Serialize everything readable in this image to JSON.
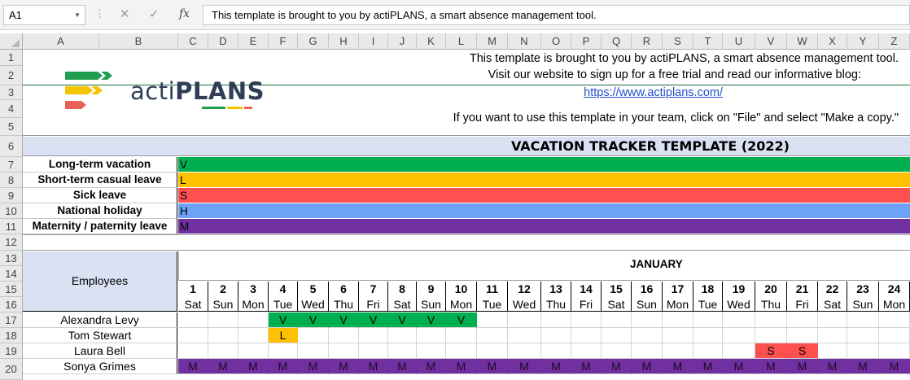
{
  "formula_bar": {
    "name_box": "A1",
    "cancel_icon": "✕",
    "enter_icon": "✓",
    "fx_icon": "fx",
    "formula": "This template is brought to you by actiPLANS, a smart absence management tool."
  },
  "columns": [
    "A",
    "B",
    "C",
    "D",
    "E",
    "F",
    "G",
    "H",
    "I",
    "J",
    "K",
    "L",
    "M",
    "N",
    "O",
    "P",
    "Q",
    "R",
    "S",
    "T",
    "U",
    "V",
    "W",
    "X",
    "Y",
    "Z"
  ],
  "rows": [
    "1",
    "2",
    "3",
    "4",
    "5",
    "6",
    "7",
    "8",
    "9",
    "10",
    "11",
    "12",
    "13",
    "14",
    "15",
    "16",
    "17",
    "18",
    "19",
    "20"
  ],
  "logo": {
    "text_a": "acti",
    "text_b": "PLANS"
  },
  "info": {
    "line1": "This template is brought to you by actiPLANS, a smart absence management tool.",
    "line2": "Visit our website to sign up for a free trial and read our informative blog:",
    "link": "https://www.actiplans.com/",
    "line4": "If you want to use this template in your team, click on \"File\" and select \"Make a copy.\""
  },
  "title": "VACATION TRACKER TEMPLATE (2022)",
  "legend": [
    {
      "label": "Long-term vacation",
      "code": "V",
      "color": "#00b050"
    },
    {
      "label": "Short-term casual leave",
      "code": "L",
      "color": "#ffc000"
    },
    {
      "label": "Sick leave",
      "code": "S",
      "color": "#ff5050"
    },
    {
      "label": "National holiday",
      "code": "H",
      "color": "#6ea2f6"
    },
    {
      "label": "Maternity / paternity leave",
      "code": "M",
      "color": "#7030a0"
    }
  ],
  "employees_header": "Employees",
  "month": "JANUARY",
  "days": [
    {
      "num": "1",
      "name": "Sat"
    },
    {
      "num": "2",
      "name": "Sun"
    },
    {
      "num": "3",
      "name": "Mon"
    },
    {
      "num": "4",
      "name": "Tue"
    },
    {
      "num": "5",
      "name": "Wed"
    },
    {
      "num": "6",
      "name": "Thu"
    },
    {
      "num": "7",
      "name": "Fri"
    },
    {
      "num": "8",
      "name": "Sat"
    },
    {
      "num": "9",
      "name": "Sun"
    },
    {
      "num": "10",
      "name": "Mon"
    },
    {
      "num": "11",
      "name": "Tue"
    },
    {
      "num": "12",
      "name": "Wed"
    },
    {
      "num": "13",
      "name": "Thu"
    },
    {
      "num": "14",
      "name": "Fri"
    },
    {
      "num": "15",
      "name": "Sat"
    },
    {
      "num": "16",
      "name": "Sun"
    },
    {
      "num": "17",
      "name": "Mon"
    },
    {
      "num": "18",
      "name": "Tue"
    },
    {
      "num": "19",
      "name": "Wed"
    },
    {
      "num": "20",
      "name": "Thu"
    },
    {
      "num": "21",
      "name": "Fri"
    },
    {
      "num": "22",
      "name": "Sat"
    },
    {
      "num": "23",
      "name": "Sun"
    },
    {
      "num": "24",
      "name": "Mon"
    }
  ],
  "employees": [
    {
      "name": "Alexandra Levy",
      "absences": {
        "4": "V",
        "5": "V",
        "6": "V",
        "7": "V",
        "8": "V",
        "9": "V",
        "10": "V"
      }
    },
    {
      "name": "Tom Stewart",
      "absences": {
        "4": "L"
      }
    },
    {
      "name": "Laura Bell",
      "absences": {
        "20": "S",
        "21": "S"
      }
    },
    {
      "name": "Sonya Grimes",
      "absences": {
        "1": "M",
        "2": "M",
        "3": "M",
        "4": "M",
        "5": "M",
        "6": "M",
        "7": "M",
        "8": "M",
        "9": "M",
        "10": "M",
        "11": "M",
        "12": "M",
        "13": "M",
        "14": "M",
        "15": "M",
        "16": "M",
        "17": "M",
        "18": "M",
        "19": "M",
        "20": "M",
        "21": "M",
        "22": "M",
        "23": "M",
        "24": "M"
      }
    }
  ],
  "colors": {
    "header_fill": "#d9e1f2",
    "grid_header": "#e9e9e9",
    "logo_green": "#1f6b3a"
  }
}
